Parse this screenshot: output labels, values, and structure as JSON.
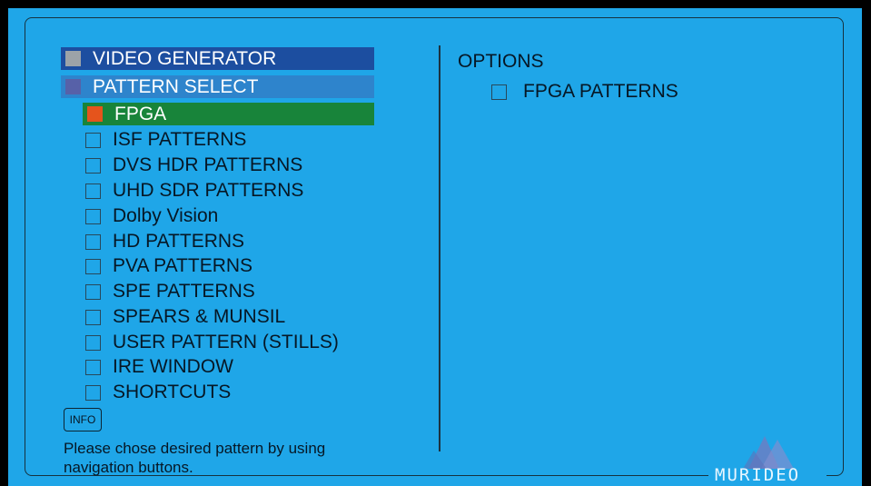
{
  "header": {
    "video_generator": "VIDEO GENERATOR",
    "pattern_select": "PATTERN SELECT"
  },
  "pattern_list": {
    "selected": "FPGA",
    "items": [
      "ISF PATTERNS",
      "DVS HDR PATTERNS",
      "UHD SDR PATTERNS",
      "Dolby Vision",
      "HD PATTERNS",
      "PVA PATTERNS",
      "SPE PATTERNS",
      "SPEARS & MUNSIL",
      "USER PATTERN (STILLS)",
      "IRE WINDOW",
      "SHORTCUTS"
    ]
  },
  "options": {
    "title": "OPTIONS",
    "item": "FPGA PATTERNS"
  },
  "info_button": "INFO",
  "help_text": "Please chose desired pattern by using navigation buttons.",
  "brand": {
    "name": "MURIDEO"
  },
  "colors": {
    "background": "#1fa6e8",
    "header_dark": "#1c4ea0",
    "header_light": "#2e84cc",
    "selected_bg": "#18843a",
    "selected_marker": "#e5541c"
  }
}
